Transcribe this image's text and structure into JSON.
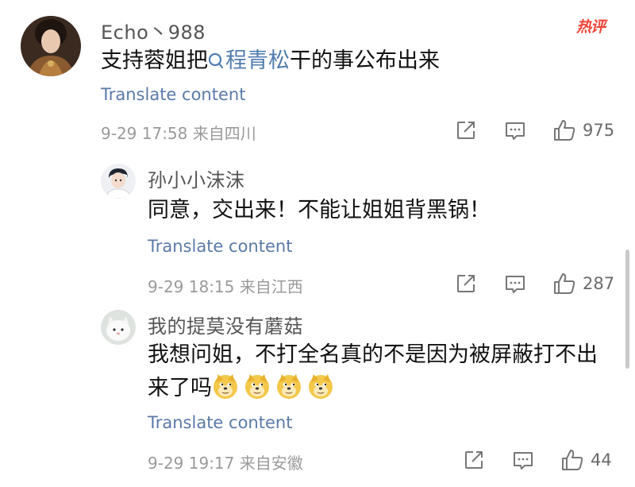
{
  "comments": [
    {
      "username": "Echo丶988",
      "text_before": "支持蓉姐把",
      "mention": "程青松",
      "text_after": "干的事公布出来",
      "translate_label": "Translate content",
      "meta": "9-29 17:58  来自四川",
      "likes": "975",
      "hot_badge": "热评",
      "accent": "#507daf"
    },
    {
      "username": "孙小小沫沫",
      "text": "同意，交出来！不能让姐姐背黑锅！",
      "translate_label": "Translate content",
      "meta": "9-29 18:15  来自江西",
      "likes": "287"
    },
    {
      "username": "我的提莫没有蘑菇",
      "text_line1": "我想问姐，不打全名真的不是因为被屏蔽打不出",
      "text_line2": "来了吗",
      "emoji": [
        "doge-emoji",
        "doge-emoji",
        "doge-emoji",
        "doge-emoji"
      ],
      "translate_label": "Translate content",
      "meta": "9-29 19:17  来自安徽",
      "likes": "44"
    }
  ],
  "icons": {
    "share": "share-icon",
    "comment": "comment-icon",
    "like": "thumbs-up-icon"
  }
}
